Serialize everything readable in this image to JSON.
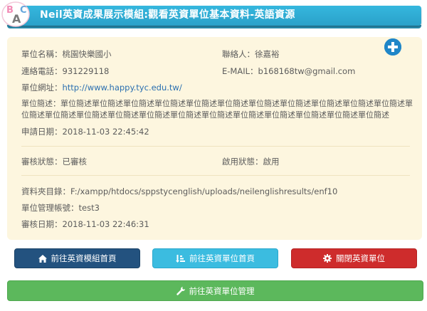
{
  "header": {
    "title": "Neil英資成果展示模組:觀看英資單位基本資料-英語資源",
    "logo_letters": [
      "B",
      "A",
      "C"
    ],
    "accent": "#2aa1c9"
  },
  "details": {
    "unit_name_label": "單位名稱：",
    "unit_name": "桃園快樂國小",
    "contact_label": "聯絡人：",
    "contact": "徐嘉裕",
    "phone_label": "連絡電話：",
    "phone": "931229118",
    "email_label": "E-MAIL：",
    "email": "b168168tw@gmail.com",
    "url_label": "單位網址：",
    "url": "http://www.happy.tyc.edu.tw/",
    "desc_label": "單位簡述：",
    "desc": "單位簡述單位簡述單位簡述單位簡述單位簡述單位簡述單位簡述單位簡述單位簡述單位簡述單位簡述單位簡述單位簡述單位簡述單位簡述單位簡述單位簡述單位簡述單位簡述單位簡述單位簡述單位簡述單位簡述",
    "apply_date_label": "申請日期：",
    "apply_date": "2018-11-03 22:45:42",
    "review_status_label": "審核狀態：",
    "review_status": "已審核",
    "enable_status_label": "啟用狀態：",
    "enable_status": "啟用",
    "folder_label": "資料夾目錄：",
    "folder": "F:/xampp/htdocs/sppstycenglish/uploads/neilenglishresults/enf10",
    "account_label": "單位管理帳號：",
    "account": "test3",
    "review_date_label": "審核日期：",
    "review_date": "2018-11-03 22:46:31"
  },
  "buttons": {
    "home": "前往英資模組首頁",
    "unit_home": "前往英資單位首頁",
    "close_unit": "關閉英資單位",
    "manage": "前往英資單位管理"
  },
  "icons": {
    "add": "plus-circle-icon",
    "home": "home-icon",
    "unit_home": "sort-amount-icon",
    "close_unit": "gear-icon",
    "manage": "wrench-icon"
  },
  "colors": {
    "panel_bg": "#fdf6df",
    "home_btn": "#23527f",
    "unit_btn": "#3bbce0",
    "close_btn": "#ce2c2c",
    "manage_btn": "#5cb85c",
    "link": "#2a6fb0"
  }
}
